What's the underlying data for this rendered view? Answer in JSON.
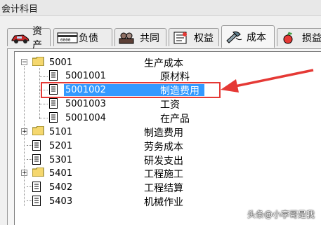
{
  "window": {
    "title": "会计科目"
  },
  "tabs": [
    {
      "label": "资产",
      "icon": "car-icon"
    },
    {
      "label": "负债",
      "icon": "card-icon"
    },
    {
      "label": "共同",
      "icon": "people-icon"
    },
    {
      "label": "权益",
      "icon": "document-icon"
    },
    {
      "label": "成本",
      "icon": "tools-icon",
      "active": true
    },
    {
      "label": "损益",
      "icon": "apple-icon"
    }
  ],
  "tree": [
    {
      "code": "5001",
      "name": "生产成本",
      "level": 0,
      "type": "folder",
      "expanded": true
    },
    {
      "code": "5001001",
      "name": "原材料",
      "level": 1,
      "type": "doc"
    },
    {
      "code": "5001002",
      "name": "制造费用",
      "level": 1,
      "type": "doc",
      "selected": true
    },
    {
      "code": "5001003",
      "name": "工资",
      "level": 1,
      "type": "doc"
    },
    {
      "code": "5001004",
      "name": "在产品",
      "level": 1,
      "type": "doc"
    },
    {
      "code": "5101",
      "name": "制造费用",
      "level": 0,
      "type": "folder",
      "expanded": false
    },
    {
      "code": "5201",
      "name": "劳务成本",
      "level": 0,
      "type": "doc"
    },
    {
      "code": "5301",
      "name": "研发支出",
      "level": 0,
      "type": "doc"
    },
    {
      "code": "5401",
      "name": "工程施工",
      "level": 0,
      "type": "folder",
      "expanded": false
    },
    {
      "code": "5402",
      "name": "工程结算",
      "level": 0,
      "type": "doc"
    },
    {
      "code": "5403",
      "name": "机械作业",
      "level": 0,
      "type": "doc"
    }
  ],
  "watermark": "头条@小李哥是我",
  "colors": {
    "selection": "#3399ff",
    "highlight_box": "#e53935",
    "arrow": "#e53935"
  }
}
